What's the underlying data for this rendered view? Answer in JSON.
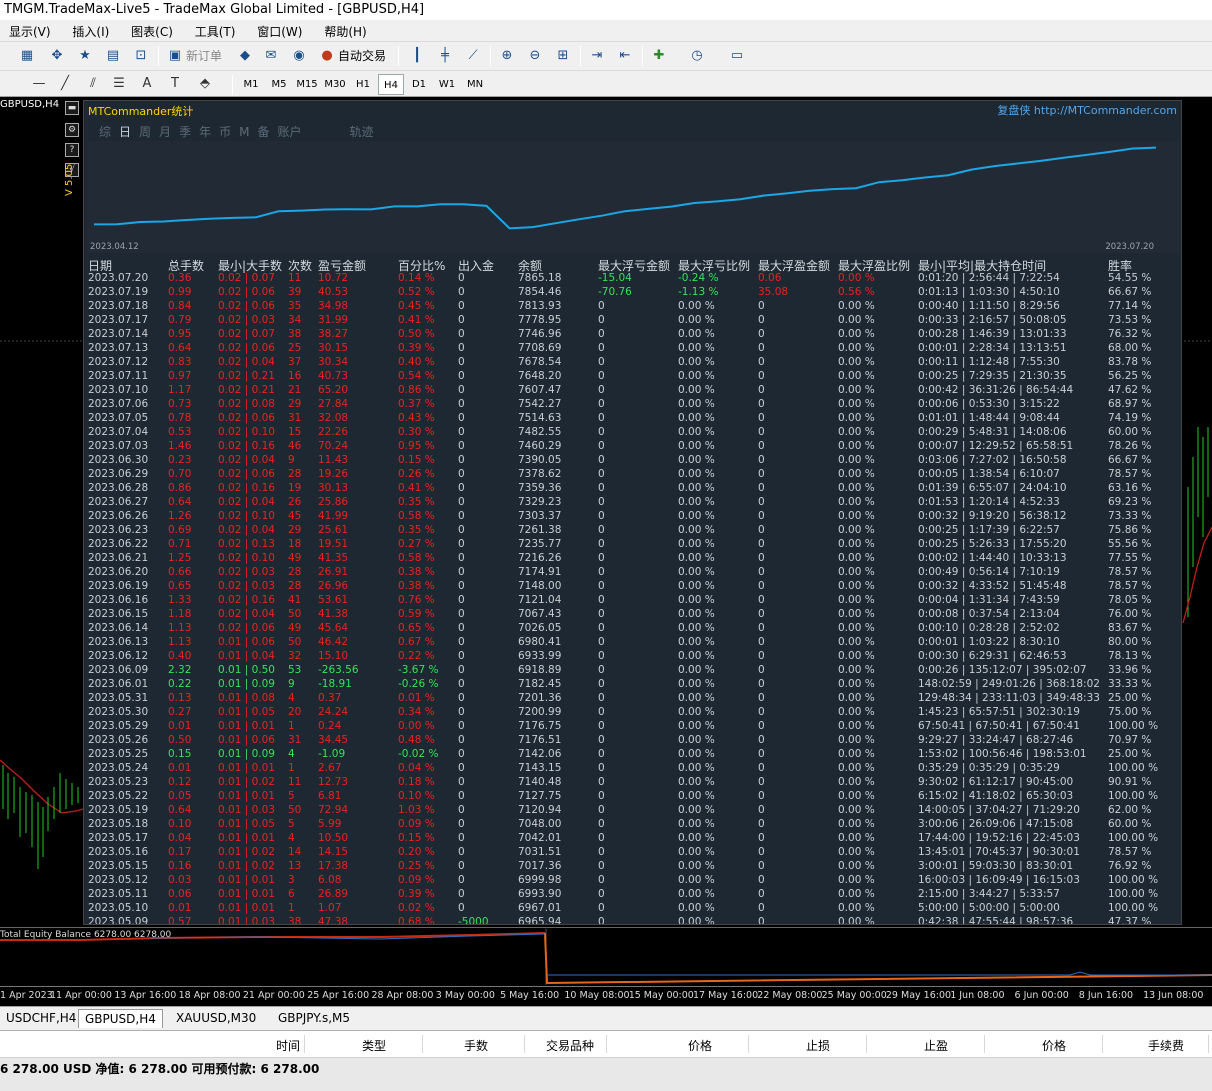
{
  "window": {
    "title": "TMGM.TradeMax-Live5 - TradeMax Global Limited - [GBPUSD,H4]"
  },
  "menu": [
    "显示(V)",
    "插入(I)",
    "图表(C)",
    "工具(T)",
    "窗口(W)",
    "帮助(H)"
  ],
  "toolbar": {
    "new_order": "新订单",
    "auto_trade": "自动交易"
  },
  "periods": [
    "M1",
    "M5",
    "M15",
    "M30",
    "H1",
    "H4",
    "D1",
    "W1",
    "MN"
  ],
  "active_period": "H4",
  "chart": {
    "symbol_tag": "GBPUSD,H4",
    "version_tag": "V 5.05"
  },
  "panel": {
    "title": "MTCommander统计",
    "link": "复盘侠 http://MTCommander.com",
    "tabs": [
      "综",
      "日",
      "周",
      "月",
      "季",
      "年",
      "币",
      "M",
      "备",
      "账户",
      "轨迹"
    ],
    "active_tab": "日",
    "eq_start": "2023.04.12",
    "eq_end": "2023.07.20",
    "headers": [
      "日期",
      "总手数",
      "最小|大手数",
      "次数",
      "盈亏金额",
      "百分比%",
      "出入金",
      "余额",
      "最大浮亏金额",
      "最大浮亏比例",
      "最大浮盈金额",
      "最大浮盈比例",
      "最小|平均|最大持仓时间",
      "胜率"
    ],
    "rows": [
      [
        "2023.07.20",
        "0.36",
        "0.02 | 0.07",
        "11",
        "10.72",
        "0.14 %",
        "0",
        "7865.18",
        "-15.04",
        "-0.24 %",
        "0.06",
        "0.00 %",
        "0:01:20 | 2:56:44 | 7:22:54",
        "54.55 %"
      ],
      [
        "2023.07.19",
        "0.99",
        "0.02 | 0.06",
        "39",
        "40.53",
        "0.52 %",
        "0",
        "7854.46",
        "-70.76",
        "-1.13 %",
        "35.08",
        "0.56 %",
        "0:01:13 | 1:03:30 | 4:50:10",
        "66.67 %"
      ],
      [
        "2023.07.18",
        "0.84",
        "0.02 | 0.06",
        "35",
        "34.98",
        "0.45 %",
        "0",
        "7813.93",
        "0",
        "0.00 %",
        "0",
        "0.00 %",
        "0:00:40 | 1:11:50 | 8:29:56",
        "77.14 %"
      ],
      [
        "2023.07.17",
        "0.79",
        "0.02 | 0.03",
        "34",
        "31.99",
        "0.41 %",
        "0",
        "7778.95",
        "0",
        "0.00 %",
        "0",
        "0.00 %",
        "0:00:33 | 2:16:57 | 50:08:05",
        "73.53 %"
      ],
      [
        "2023.07.14",
        "0.95",
        "0.02 | 0.07",
        "38",
        "38.27",
        "0.50 %",
        "0",
        "7746.96",
        "0",
        "0.00 %",
        "0",
        "0.00 %",
        "0:00:28 | 1:46:39 | 13:01:33",
        "76.32 %"
      ],
      [
        "2023.07.13",
        "0.64",
        "0.02 | 0.06",
        "25",
        "30.15",
        "0.39 %",
        "0",
        "7708.69",
        "0",
        "0.00 %",
        "0",
        "0.00 %",
        "0:00:01 | 2:28:34 | 13:13:51",
        "68.00 %"
      ],
      [
        "2023.07.12",
        "0.83",
        "0.02 | 0.04",
        "37",
        "30.34",
        "0.40 %",
        "0",
        "7678.54",
        "0",
        "0.00 %",
        "0",
        "0.00 %",
        "0:00:11 | 1:12:48 | 7:55:30",
        "83.78 %"
      ],
      [
        "2023.07.11",
        "0.97",
        "0.02 | 0.21",
        "16",
        "40.73",
        "0.54 %",
        "0",
        "7648.20",
        "0",
        "0.00 %",
        "0",
        "0.00 %",
        "0:00:25 | 7:29:35 | 21:30:35",
        "56.25 %"
      ],
      [
        "2023.07.10",
        "1.17",
        "0.02 | 0.21",
        "21",
        "65.20",
        "0.86 %",
        "0",
        "7607.47",
        "0",
        "0.00 %",
        "0",
        "0.00 %",
        "0:00:42 | 36:31:26 | 86:54:44",
        "47.62 %"
      ],
      [
        "2023.07.06",
        "0.73",
        "0.02 | 0.08",
        "29",
        "27.84",
        "0.37 %",
        "0",
        "7542.27",
        "0",
        "0.00 %",
        "0",
        "0.00 %",
        "0:00:06 | 0:53:30 | 3:15:22",
        "68.97 %"
      ],
      [
        "2023.07.05",
        "0.78",
        "0.02 | 0.06",
        "31",
        "32.08",
        "0.43 %",
        "0",
        "7514.63",
        "0",
        "0.00 %",
        "0",
        "0.00 %",
        "0:01:01 | 1:48:44 | 9:08:44",
        "74.19 %"
      ],
      [
        "2023.07.04",
        "0.53",
        "0.02 | 0.10",
        "15",
        "22.26",
        "0.30 %",
        "0",
        "7482.55",
        "0",
        "0.00 %",
        "0",
        "0.00 %",
        "0:00:29 | 5:48:31 | 14:08:06",
        "60.00 %"
      ],
      [
        "2023.07.03",
        "1.46",
        "0.02 | 0.16",
        "46",
        "70.24",
        "0.95 %",
        "0",
        "7460.29",
        "0",
        "0.00 %",
        "0",
        "0.00 %",
        "0:00:07 | 12:29:52 | 65:58:51",
        "78.26 %"
      ],
      [
        "2023.06.30",
        "0.23",
        "0.02 | 0.04",
        "9",
        "11.43",
        "0.15 %",
        "0",
        "7390.05",
        "0",
        "0.00 %",
        "0",
        "0.00 %",
        "0:03:06 | 7:27:02 | 16:50:58",
        "66.67 %"
      ],
      [
        "2023.06.29",
        "0.70",
        "0.02 | 0.06",
        "28",
        "19.26",
        "0.26 %",
        "0",
        "7378.62",
        "0",
        "0.00 %",
        "0",
        "0.00 %",
        "0:00:05 | 1:38:54 | 6:10:07",
        "78.57 %"
      ],
      [
        "2023.06.28",
        "0.86",
        "0.02 | 0.16",
        "19",
        "30.13",
        "0.41 %",
        "0",
        "7359.36",
        "0",
        "0.00 %",
        "0",
        "0.00 %",
        "0:01:39 | 6:55:07 | 24:04:10",
        "63.16 %"
      ],
      [
        "2023.06.27",
        "0.64",
        "0.02 | 0.04",
        "26",
        "25.86",
        "0.35 %",
        "0",
        "7329.23",
        "0",
        "0.00 %",
        "0",
        "0.00 %",
        "0:01:53 | 1:20:14 | 4:52:33",
        "69.23 %"
      ],
      [
        "2023.06.26",
        "1.26",
        "0.02 | 0.10",
        "45",
        "41.99",
        "0.58 %",
        "0",
        "7303.37",
        "0",
        "0.00 %",
        "0",
        "0.00 %",
        "0:00:32 | 9:19:20 | 56:38:12",
        "73.33 %"
      ],
      [
        "2023.06.23",
        "0.69",
        "0.02 | 0.04",
        "29",
        "25.61",
        "0.35 %",
        "0",
        "7261.38",
        "0",
        "0.00 %",
        "0",
        "0.00 %",
        "0:00:25 | 1:17:39 | 6:22:57",
        "75.86 %"
      ],
      [
        "2023.06.22",
        "0.71",
        "0.02 | 0.13",
        "18",
        "19.51",
        "0.27 %",
        "0",
        "7235.77",
        "0",
        "0.00 %",
        "0",
        "0.00 %",
        "0:00:25 | 5:26:33 | 17:55:20",
        "55.56 %"
      ],
      [
        "2023.06.21",
        "1.25",
        "0.02 | 0.10",
        "49",
        "41.35",
        "0.58 %",
        "0",
        "7216.26",
        "0",
        "0.00 %",
        "0",
        "0.00 %",
        "0:00:02 | 1:44:40 | 10:33:13",
        "77.55 %"
      ],
      [
        "2023.06.20",
        "0.66",
        "0.02 | 0.03",
        "28",
        "26.91",
        "0.38 %",
        "0",
        "7174.91",
        "0",
        "0.00 %",
        "0",
        "0.00 %",
        "0:00:49 | 0:56:14 | 7:10:19",
        "78.57 %"
      ],
      [
        "2023.06.19",
        "0.65",
        "0.02 | 0.03",
        "28",
        "26.96",
        "0.38 %",
        "0",
        "7148.00",
        "0",
        "0.00 %",
        "0",
        "0.00 %",
        "0:00:32 | 4:33:52 | 51:45:48",
        "78.57 %"
      ],
      [
        "2023.06.16",
        "1.33",
        "0.02 | 0.16",
        "41",
        "53.61",
        "0.76 %",
        "0",
        "7121.04",
        "0",
        "0.00 %",
        "0",
        "0.00 %",
        "0:00:04 | 1:31:34 | 7:43:59",
        "78.05 %"
      ],
      [
        "2023.06.15",
        "1.18",
        "0.02 | 0.04",
        "50",
        "41.38",
        "0.59 %",
        "0",
        "7067.43",
        "0",
        "0.00 %",
        "0",
        "0.00 %",
        "0:00:08 | 0:37:54 | 2:13:04",
        "76.00 %"
      ],
      [
        "2023.06.14",
        "1.13",
        "0.02 | 0.06",
        "49",
        "45.64",
        "0.65 %",
        "0",
        "7026.05",
        "0",
        "0.00 %",
        "0",
        "0.00 %",
        "0:00:10 | 0:28:28 | 2:52:02",
        "83.67 %"
      ],
      [
        "2023.06.13",
        "1.13",
        "0.01 | 0.06",
        "50",
        "46.42",
        "0.67 %",
        "0",
        "6980.41",
        "0",
        "0.00 %",
        "0",
        "0.00 %",
        "0:00:01 | 1:03:22 | 8:30:10",
        "80.00 %"
      ],
      [
        "2023.06.12",
        "0.40",
        "0.01 | 0.04",
        "32",
        "15.10",
        "0.22 %",
        "0",
        "6933.99",
        "0",
        "0.00 %",
        "0",
        "0.00 %",
        "0:00:30 | 6:29:31 | 62:46:53",
        "78.13 %"
      ],
      [
        "2023.06.09",
        "2.32",
        "0.01 | 0.50",
        "53",
        "-263.56",
        "-3.67 %",
        "0",
        "6918.89",
        "0",
        "0.00 %",
        "0",
        "0.00 %",
        "0:00:26 | 135:12:07 | 395:02:07",
        "33.96 %"
      ],
      [
        "2023.06.01",
        "0.22",
        "0.01 | 0.09",
        "9",
        "-18.91",
        "-0.26 %",
        "0",
        "7182.45",
        "0",
        "0.00 %",
        "0",
        "0.00 %",
        "148:02:59 | 249:01:26 | 368:18:02",
        "33.33 %"
      ],
      [
        "2023.05.31",
        "0.13",
        "0.01 | 0.08",
        "4",
        "0.37",
        "0.01 %",
        "0",
        "7201.36",
        "0",
        "0.00 %",
        "0",
        "0.00 %",
        "129:48:34 | 233:11:03 | 349:48:33",
        "25.00 %"
      ],
      [
        "2023.05.30",
        "0.27",
        "0.01 | 0.05",
        "20",
        "24.24",
        "0.34 %",
        "0",
        "7200.99",
        "0",
        "0.00 %",
        "0",
        "0.00 %",
        "1:45:23 | 65:57:51 | 302:30:19",
        "75.00 %"
      ],
      [
        "2023.05.29",
        "0.01",
        "0.01 | 0.01",
        "1",
        "0.24",
        "0.00 %",
        "0",
        "7176.75",
        "0",
        "0.00 %",
        "0",
        "0.00 %",
        "67:50:41 | 67:50:41 | 67:50:41",
        "100.00 %"
      ],
      [
        "2023.05.26",
        "0.50",
        "0.01 | 0.06",
        "31",
        "34.45",
        "0.48 %",
        "0",
        "7176.51",
        "0",
        "0.00 %",
        "0",
        "0.00 %",
        "9:29:27 | 33:24:47 | 68:27:46",
        "70.97 %"
      ],
      [
        "2023.05.25",
        "0.15",
        "0.01 | 0.09",
        "4",
        "-1.09",
        "-0.02 %",
        "0",
        "7142.06",
        "0",
        "0.00 %",
        "0",
        "0.00 %",
        "1:53:02 | 100:56:46 | 198:53:01",
        "25.00 %"
      ],
      [
        "2023.05.24",
        "0.01",
        "0.01 | 0.01",
        "1",
        "2.67",
        "0.04 %",
        "0",
        "7143.15",
        "0",
        "0.00 %",
        "0",
        "0.00 %",
        "0:35:29 | 0:35:29 | 0:35:29",
        "100.00 %"
      ],
      [
        "2023.05.23",
        "0.12",
        "0.01 | 0.02",
        "11",
        "12.73",
        "0.18 %",
        "0",
        "7140.48",
        "0",
        "0.00 %",
        "0",
        "0.00 %",
        "9:30:02 | 61:12:17 | 90:45:00",
        "90.91 %"
      ],
      [
        "2023.05.22",
        "0.05",
        "0.01 | 0.01",
        "5",
        "6.81",
        "0.10 %",
        "0",
        "7127.75",
        "0",
        "0.00 %",
        "0",
        "0.00 %",
        "6:15:02 | 41:18:02 | 65:30:03",
        "100.00 %"
      ],
      [
        "2023.05.19",
        "0.64",
        "0.01 | 0.03",
        "50",
        "72.94",
        "1.03 %",
        "0",
        "7120.94",
        "0",
        "0.00 %",
        "0",
        "0.00 %",
        "14:00:05 | 37:04:27 | 71:29:20",
        "62.00 %"
      ],
      [
        "2023.05.18",
        "0.10",
        "0.01 | 0.05",
        "5",
        "5.99",
        "0.09 %",
        "0",
        "7048.00",
        "0",
        "0.00 %",
        "0",
        "0.00 %",
        "3:00:06 | 26:09:06 | 47:15:08",
        "60.00 %"
      ],
      [
        "2023.05.17",
        "0.04",
        "0.01 | 0.01",
        "4",
        "10.50",
        "0.15 %",
        "0",
        "7042.01",
        "0",
        "0.00 %",
        "0",
        "0.00 %",
        "17:44:00 | 19:52:16 | 22:45:03",
        "100.00 %"
      ],
      [
        "2023.05.16",
        "0.17",
        "0.01 | 0.02",
        "14",
        "14.15",
        "0.20 %",
        "0",
        "7031.51",
        "0",
        "0.00 %",
        "0",
        "0.00 %",
        "13:45:01 | 70:45:37 | 90:30:01",
        "78.57 %"
      ],
      [
        "2023.05.15",
        "0.16",
        "0.01 | 0.02",
        "13",
        "17.38",
        "0.25 %",
        "0",
        "7017.36",
        "0",
        "0.00 %",
        "0",
        "0.00 %",
        "3:00:01 | 59:03:30 | 83:30:01",
        "76.92 %"
      ],
      [
        "2023.05.12",
        "0.03",
        "0.01 | 0.01",
        "3",
        "6.08",
        "0.09 %",
        "0",
        "6999.98",
        "0",
        "0.00 %",
        "0",
        "0.00 %",
        "16:00:03 | 16:09:49 | 16:15:03",
        "100.00 %"
      ],
      [
        "2023.05.11",
        "0.06",
        "0.01 | 0.01",
        "6",
        "26.89",
        "0.39 %",
        "0",
        "6993.90",
        "0",
        "0.00 %",
        "0",
        "0.00 %",
        "2:15:00 | 3:44:27 | 5:33:57",
        "100.00 %"
      ],
      [
        "2023.05.10",
        "0.01",
        "0.01 | 0.01",
        "1",
        "1.07",
        "0.02 %",
        "0",
        "6967.01",
        "0",
        "0.00 %",
        "0",
        "0.00 %",
        "5:00:00 | 5:00:00 | 5:00:00",
        "100.00 %"
      ],
      [
        "2023.05.09",
        "0.57",
        "0.01 | 0.03",
        "38",
        "47.38",
        "0.68 %",
        "-5000",
        "6965.94",
        "0",
        "0.00 %",
        "0",
        "0.00 %",
        "0:42:38 | 47:55:44 | 98:57:36",
        "47.37 %"
      ]
    ]
  },
  "equity_indicator": {
    "label": "Total Equity Balance 6278.00 6278.00"
  },
  "x_axis": [
    "1 Apr 2023",
    "11 Apr 00:00",
    "13 Apr 16:00",
    "18 Apr 08:00",
    "21 Apr 00:00",
    "25 Apr 16:00",
    "28 Apr 08:00",
    "3 May 00:00",
    "5 May 16:00",
    "10 May 08:00",
    "15 May 00:00",
    "17 May 16:00",
    "22 May 08:00",
    "25 May 00:00",
    "29 May 16:00",
    "1 Jun 08:00",
    "6 Jun 00:00",
    "8 Jun 16:00",
    "13 Jun 08:00"
  ],
  "chart_tabs": [
    "USDCHF,H4",
    "GBPUSD,H4",
    "XAUUSD,M30",
    "GBPJPY.s,M5"
  ],
  "active_chart_tab": "GBPUSD,H4",
  "terminal": {
    "headers": [
      "时间",
      "类型",
      "手数",
      "交易品种",
      "价格",
      "止损",
      "止盈",
      "价格",
      "手续费"
    ],
    "balance_text": "6 278.00 USD  净值: 6 278.00  可用预付款: 6 278.00"
  },
  "colors": {
    "positive_red": "#ee2020",
    "negative_green": "#34e35a",
    "equity_line": "#1aa7e8",
    "panel_bg": "#1e2832"
  }
}
